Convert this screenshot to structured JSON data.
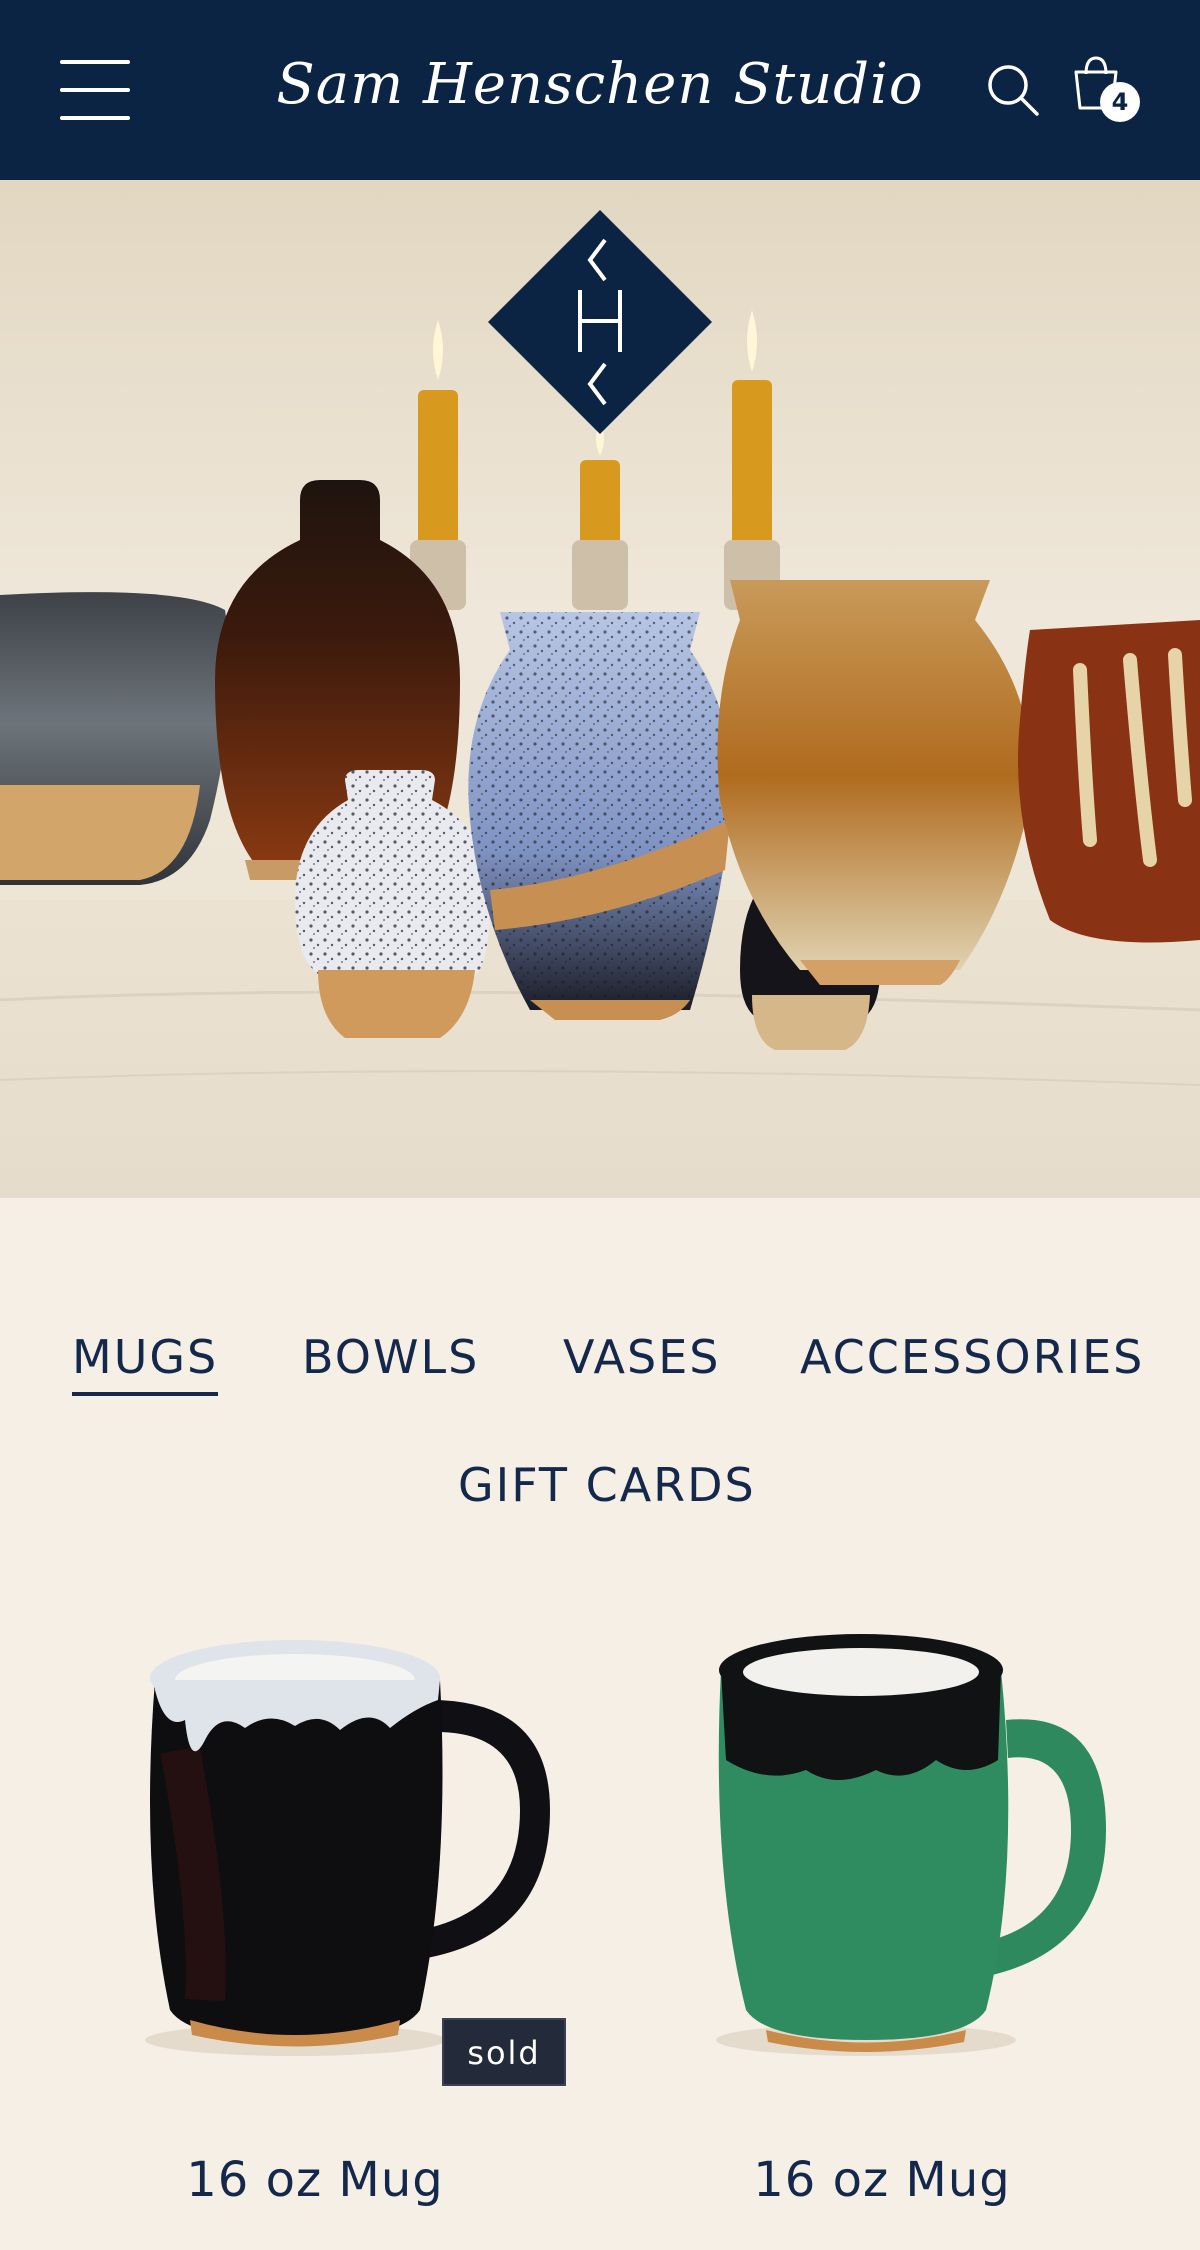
{
  "header": {
    "title": "Sam Henschen Studio",
    "cart_count": "4",
    "icons": {
      "menu": "hamburger-menu-icon",
      "search": "search-icon",
      "cart": "shopping-bag-icon"
    }
  },
  "hero": {
    "image": "pottery-collection-photo",
    "logo_text": "SHS"
  },
  "categories": {
    "items": [
      {
        "label": "MUGS",
        "active": true
      },
      {
        "label": "BOWLS",
        "active": false
      },
      {
        "label": "VASES",
        "active": false
      },
      {
        "label": "ACCESSORIES",
        "active": false
      },
      {
        "label": "GIFT CARDS",
        "active": false
      }
    ]
  },
  "products": [
    {
      "name": "16 oz Mug",
      "badge": "sold",
      "glaze": "black-white-drip"
    },
    {
      "name": "16 oz Mug",
      "badge": "",
      "glaze": "green-black"
    }
  ],
  "colors": {
    "header_bg": "#0c2443",
    "page_bg": "#f5efe6",
    "text": "#13284a"
  }
}
